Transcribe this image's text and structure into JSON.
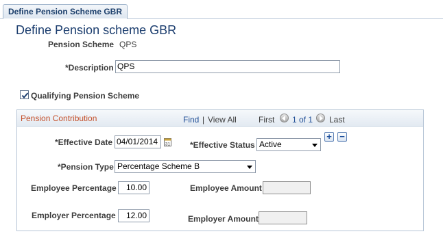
{
  "tab": {
    "label": "Define Pension Scheme GBR"
  },
  "page_title": "Define Pension scheme GBR",
  "pension_scheme": {
    "label": "Pension Scheme",
    "value": "QPS"
  },
  "description": {
    "label": "*Description",
    "value": "QPS"
  },
  "qualifying": {
    "label": "Qualifying Pension Scheme",
    "checked": true
  },
  "contribution": {
    "title": "Pension Contribution",
    "find": "Find",
    "separator": "|",
    "view_all": "View All",
    "first": "First",
    "range": "1 of 1",
    "last": "Last",
    "add": "+",
    "remove": "−",
    "effective_date": {
      "label": "*Effective Date",
      "value": "04/01/2014",
      "icon": "calendar-icon"
    },
    "effective_status": {
      "label": "*Effective Status",
      "value": "Active"
    },
    "pension_type": {
      "label": "*Pension Type",
      "value": "Percentage Scheme B"
    },
    "employee_percentage": {
      "label": "Employee Percentage",
      "value": "10.00"
    },
    "employee_amount": {
      "label": "Employee Amount",
      "value": ""
    },
    "employer_percentage": {
      "label": "Employer Percentage",
      "value": "12.00"
    },
    "employer_amount": {
      "label": "Employer Amount",
      "value": ""
    }
  },
  "colors": {
    "page_title": "#1b3d6e",
    "group_title": "#c4512c",
    "link": "#1f4e96",
    "border": "#b6c5d6"
  }
}
